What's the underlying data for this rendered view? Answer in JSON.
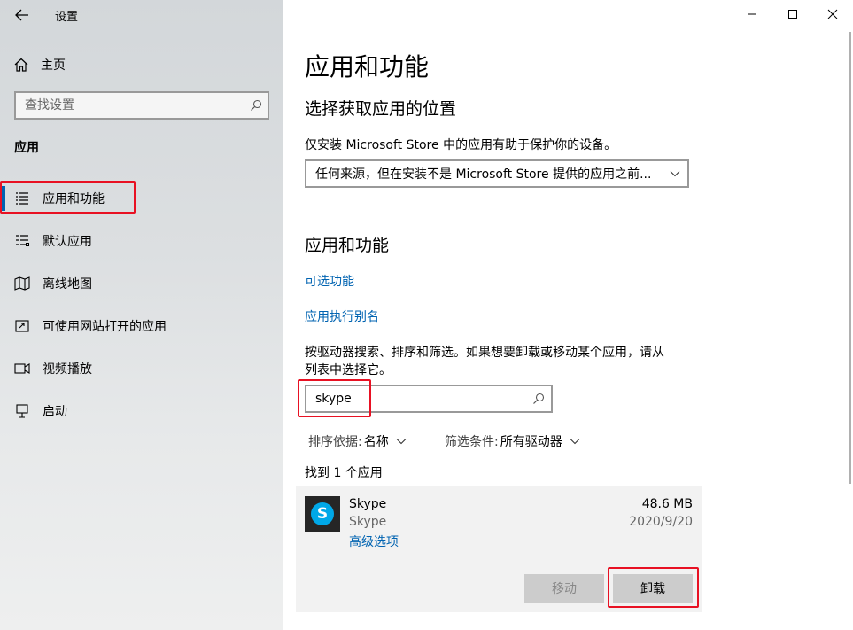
{
  "window": {
    "title": "设置",
    "controls": {
      "minimize": "minimize-icon",
      "maximize": "maximize-icon",
      "close": "close-icon"
    }
  },
  "sidebar": {
    "home_label": "主页",
    "search_placeholder": "查找设置",
    "section_title": "应用",
    "items": [
      {
        "label": "应用和功能",
        "icon": "apps-features-icon",
        "active": true
      },
      {
        "label": "默认应用",
        "icon": "default-apps-icon",
        "active": false
      },
      {
        "label": "离线地图",
        "icon": "offline-maps-icon",
        "active": false
      },
      {
        "label": "可使用网站打开的应用",
        "icon": "apps-for-websites-icon",
        "active": false
      },
      {
        "label": "视频播放",
        "icon": "video-playback-icon",
        "active": false
      },
      {
        "label": "启动",
        "icon": "startup-icon",
        "active": false
      }
    ]
  },
  "main": {
    "page_title": "应用和功能",
    "install_section": {
      "heading": "选择获取应用的位置",
      "description": "仅安装 Microsoft Store 中的应用有助于保护你的设备。",
      "dropdown_value": "任何来源，但在安装不是 Microsoft Store 提供的应用之前..."
    },
    "apps_section": {
      "heading": "应用和功能",
      "optional_features_link": "可选功能",
      "app_alias_link": "应用执行别名",
      "search_hint_line1": "按驱动器搜索、排序和筛选。如果想要卸载或移动某个应用，请从",
      "search_hint_line2": "列表中选择它。",
      "search_value": "skype",
      "sort_label": "排序依据:",
      "sort_value": "名称",
      "filter_label": "筛选条件:",
      "filter_value": "所有驱动器",
      "result_count": "找到 1 个应用"
    },
    "app": {
      "name": "Skype",
      "publisher": "Skype",
      "advanced_link": "高级选项",
      "size": "48.6 MB",
      "date": "2020/9/20",
      "move_button": "移动",
      "uninstall_button": "卸载"
    }
  },
  "colors": {
    "accent": "#0063b1",
    "highlight": "#e81123",
    "card_bg": "#f2f2f2"
  }
}
